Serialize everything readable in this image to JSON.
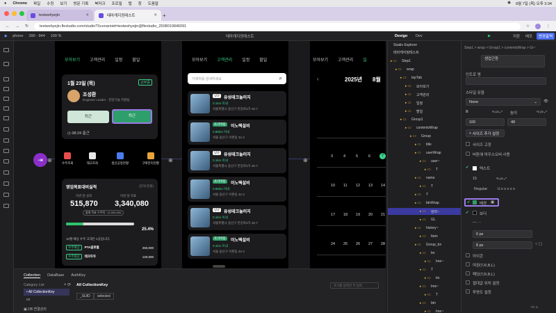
{
  "mac": {
    "app": "Chrome",
    "menus": [
      "파일",
      "수정",
      "보기",
      "방문 기록",
      "북마크",
      "프로필",
      "탭",
      "창",
      "도움말"
    ],
    "time": "8월 7일 (목) 오후 3:34"
  },
  "tabs": [
    {
      "title": "testwshyejin"
    },
    {
      "title": "테마캐지정테스트"
    }
  ],
  "address": {
    "url": "testwshyejin.flextudio.com/studio?Scenarioid=testwshyejin@flextudio_2508010846091"
  },
  "topbar": {
    "device": "phone",
    "size": "390 · 844",
    "zoom": "100 %",
    "project": "테마캐지정테스트",
    "tabs": [
      "Design",
      "Dev"
    ],
    "buttons": [
      "저장",
      "배포",
      "변경출력"
    ]
  },
  "screen1": {
    "tabs": [
      "모아보기",
      "고객관리",
      "일정",
      "할일"
    ],
    "date": "1월 23일 (목)",
    "badge": "근무중",
    "name": "조성환",
    "role": "Engineer Leader · 현장기술 지원팀",
    "tags": [
      "진행중",
      "미처리",
      "인증"
    ],
    "btn_in": "퇴근",
    "btn_out": "퇴근",
    "clock": "08:24 출근",
    "icons": [
      "수주조회",
      "재고조회",
      "생산공정현황",
      "구매관리현황"
    ],
    "sales_title": "영업목표대비실적",
    "sales_unit": "(단위:천원)",
    "month_lbl": "이번 달 실적",
    "target_lbl": "이번 달 목표",
    "month_val": "515,870",
    "target_val": "3,340,080",
    "hint": "올해 목표 수주액 : 12,000,000",
    "pct": "25.4%",
    "progress": 0.254,
    "note": "10월 예상 수주 고객은 2곳입니다.",
    "rows": [
      {
        "tag": "수주예상",
        "name": "PTA글로벌",
        "val": "250,000"
      },
      {
        "tag": "수주예상",
        "name": "테크두두",
        "val": "120,000"
      }
    ]
  },
  "screen2": {
    "tabs": [
      "모아보기",
      "고객관리",
      "일정",
      "할일"
    ],
    "search_placeholder": "거래처를 검색하세요",
    "items": [
      {
        "tag": "방문",
        "name": "유성테크놀러지",
        "dist": "0.1km 이내",
        "addr": "서울특별시 용산구 한강로3가 45-7"
      },
      {
        "tag": "초기미팅",
        "name": "이노텍설비",
        "dist": "0.85km 이내",
        "addr": "서울 용산구 이촌동 32-4"
      },
      {
        "tag": "방문",
        "name": "유성테크놀러지",
        "dist": "0.1km 이내",
        "addr": "서울특별시 용산구 한강로3가 45-7"
      },
      {
        "tag": "초기미팅",
        "name": "이노텍설비",
        "dist": "0.85km 이내",
        "addr": "서울 용산구 이촌동 32-4"
      },
      {
        "tag": "방문",
        "name": "유성테크놀러지",
        "dist": "0.1km 이내",
        "addr": "서울특별시 용산구 한강로3가 45-7"
      },
      {
        "tag": "초기미팅",
        "name": "이노텍설비",
        "dist": "0.1km 이내",
        "addr": "서울 용산구 이촌동 32-4"
      }
    ]
  },
  "screen3": {
    "tabs": [
      "모아보기",
      "고객관리",
      "일"
    ],
    "year": "2025년",
    "month": "8월",
    "weeks": [
      [
        "",
        "",
        "",
        "",
        "",
        "1",
        "2"
      ],
      [
        "3",
        "4",
        "5",
        "6",
        "7",
        "8",
        "9"
      ],
      [
        "10",
        "11",
        "12",
        "13",
        "14",
        "15",
        "16"
      ],
      [
        "17",
        "18",
        "19",
        "20",
        "21",
        "22",
        "23"
      ],
      [
        "24",
        "25",
        "26",
        "27",
        "28",
        "29",
        "30"
      ],
      [
        "31",
        "",
        "",
        "",
        "",
        "",
        ""
      ]
    ],
    "today": "7"
  },
  "bottom": {
    "tabs": [
      "Collection",
      "DataBase",
      "AuthKey"
    ],
    "category": "Category List",
    "key_title": "All CollectionKey",
    "items": [
      "All CollectionKey",
      "ce"
    ],
    "fields": [
      "_SUID",
      "selected"
    ],
    "search_placeholder": "조기를 입력한 키 입력",
    "db": "DB 연결관리"
  },
  "explorer": {
    "title": "Studio Explorer",
    "project": "테마캐지정테스트",
    "nodes": [
      "Step1",
      "wrap",
      "topTab",
      "모아보기",
      "고객관리",
      "일정",
      "할일",
      "Group1",
      "contentsWrap",
      "Group",
      "title",
      "userWrap",
      "user~",
      "T",
      "name",
      "T",
      "T",
      "btnWrap",
      "컴퍼~",
      "GL",
      "history~",
      "Item",
      "Group_bn",
      "bn",
      "Ime~",
      "T",
      "bn",
      "Ime~",
      "T",
      "btn",
      "Ime~",
      "T"
    ]
  },
  "props": {
    "breadcrumb": "Step1 > wrap > Group1 > contentsWrap > Gr~",
    "name_val": "생업근등",
    "hint": "인트로 명",
    "style_label": "스타일 유형",
    "style_val": "None",
    "size_label": "너비",
    "w": "100",
    "h": "48",
    "height_label": "높이",
    "add_size": "사이즈 추가 설정",
    "fix": "사이즈 고정",
    "hover": "버튼에 마우스오버 사용",
    "text": "텍스트",
    "font_size": "15",
    "weight": "Regular",
    "bg": "배경",
    "border": "보더",
    "b0": "0",
    "b8": "8",
    "options": [
      "아이콘",
      "여권(T,R,B,L)",
      "패딩(T,R,B,L)",
      "절대값 위치 설정",
      "투명도 설정"
    ]
  }
}
